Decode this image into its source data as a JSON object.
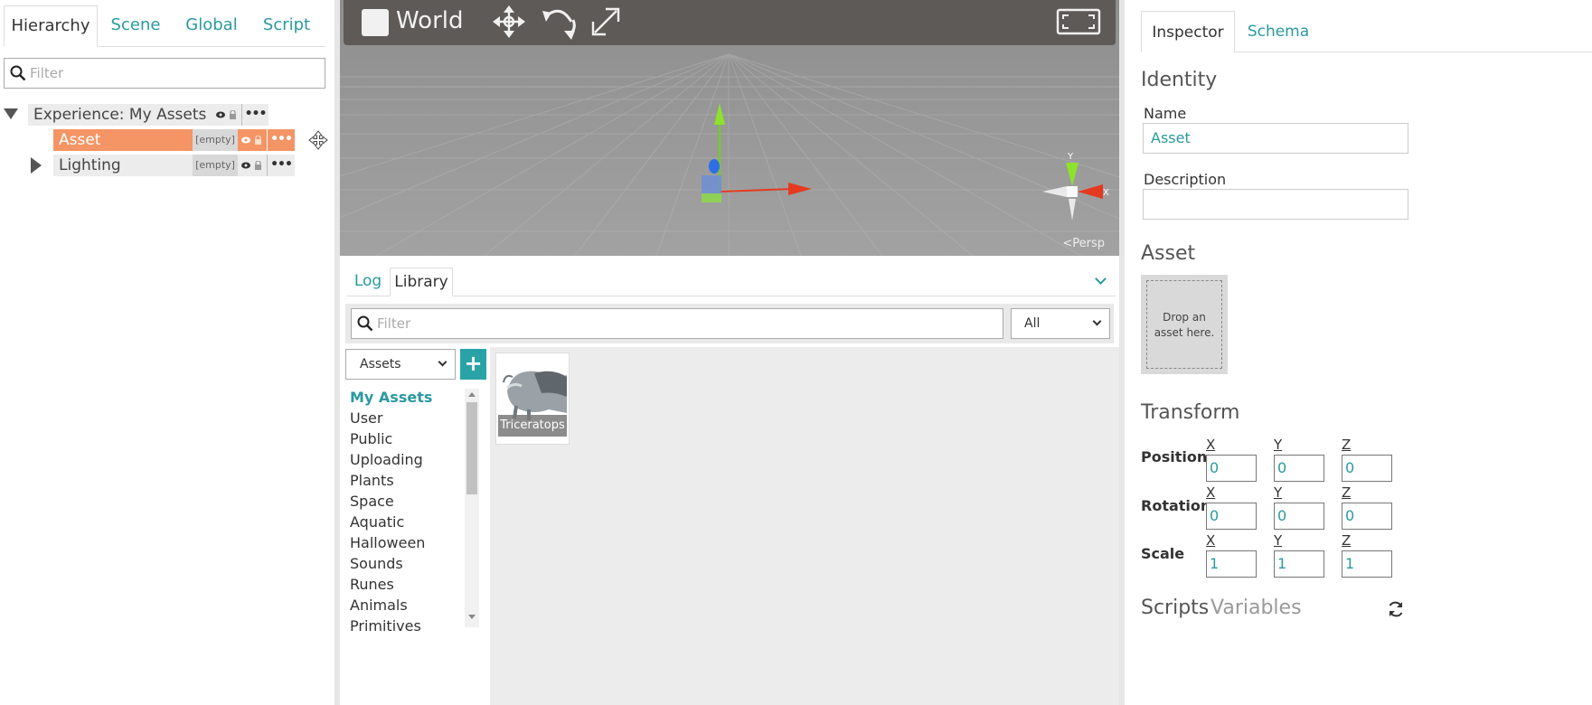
{
  "hierarchy": {
    "tabs": [
      {
        "label": "Hierarchy",
        "active": true
      },
      {
        "label": "Scene",
        "active": false
      },
      {
        "label": "Global",
        "active": false
      },
      {
        "label": "Script",
        "active": false
      }
    ],
    "filter_placeholder": "Filter",
    "tree": [
      {
        "label": "Experience: My Assets",
        "expanded": true,
        "selected": false
      },
      {
        "label": "Asset",
        "tag": "[empty]",
        "selected": true
      },
      {
        "label": "Lighting",
        "tag": "[empty]",
        "expanded": false,
        "selected": false
      }
    ]
  },
  "viewport": {
    "world_label": "World",
    "camera_label": "Persp",
    "gizmo_axes": [
      "Y",
      "X"
    ],
    "colors": {
      "x_axis": "#e53a1f",
      "y_axis": "#7ddc1f",
      "z_axis": "#2d6ee8"
    }
  },
  "library": {
    "tabs": [
      {
        "label": "Log",
        "active": false
      },
      {
        "label": "Library",
        "active": true
      }
    ],
    "filter_placeholder": "Filter",
    "type_filter": "All",
    "source_select": "Assets",
    "add_label": "+",
    "categories": [
      "My Assets",
      "User",
      "Public",
      "Uploading",
      "Plants",
      "Space",
      "Aquatic",
      "Halloween",
      "Sounds",
      "Runes",
      "Animals",
      "Primitives"
    ],
    "active_category": "My Assets",
    "items": [
      {
        "name": "Triceratops"
      }
    ]
  },
  "inspector": {
    "tabs": [
      {
        "label": "Inspector",
        "active": true
      },
      {
        "label": "Schema",
        "active": false
      }
    ],
    "identity_title": "Identity",
    "name_label": "Name",
    "name_value": "Asset",
    "description_label": "Description",
    "description_value": "",
    "asset_title": "Asset",
    "drop_text": "Drop an asset here.",
    "transform_title": "Transform",
    "axes": [
      "X",
      "Y",
      "Z"
    ],
    "position_label": "Position",
    "position": [
      "0",
      "0",
      "0"
    ],
    "rotation_label": "Rotation",
    "rotation": [
      "0",
      "0",
      "0"
    ],
    "scale_label": "Scale",
    "scale": [
      "1",
      "1",
      "1"
    ],
    "bottom_tabs": [
      "Scripts",
      "Variables"
    ]
  },
  "colors": {
    "accent": "#2a9a9f",
    "selection": "#f59464"
  }
}
